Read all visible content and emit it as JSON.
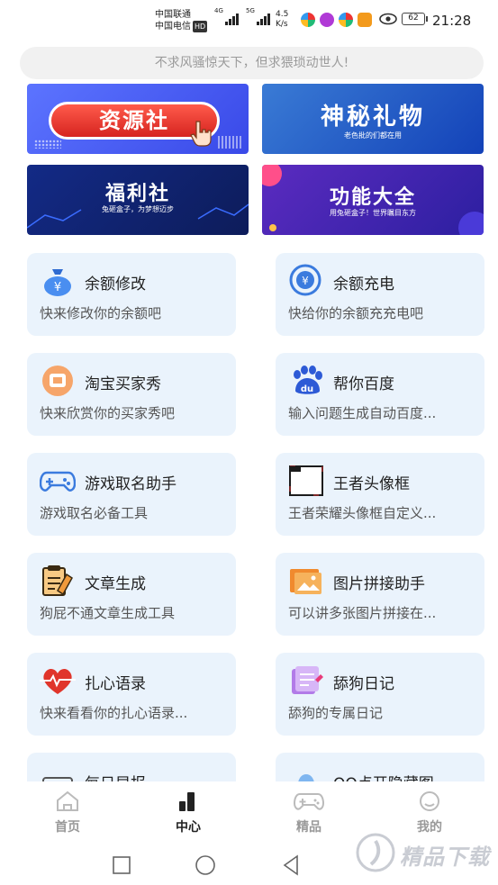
{
  "status_bar": {
    "carrier_1": "中国联通",
    "carrier_2": "中国电信",
    "hd": "HD",
    "sig1_label": "4G",
    "sig2_label": "5G",
    "speed_value": "4.5",
    "speed_unit": "K/s",
    "battery": "62",
    "time": "21:28"
  },
  "slogan": "不求风骚惊天下，但求猥琐动世人!",
  "banners": [
    {
      "title": "资源社",
      "subtitle": ""
    },
    {
      "title": "神秘礼物",
      "subtitle": "老色批的们都在用"
    },
    {
      "title": "福利社",
      "subtitle": "兔砸盒子，为梦想迈步"
    },
    {
      "title": "功能大全",
      "subtitle": "用兔砸盒子！世界瞩目东方"
    }
  ],
  "cards": [
    {
      "title": "余额修改",
      "desc": "快来修改你的余额吧",
      "icon": "money-bag-icon"
    },
    {
      "title": "余额充电",
      "desc": "快给你的余额充充电吧",
      "icon": "yen-coin-icon"
    },
    {
      "title": "淘宝买家秀",
      "desc": "快来欣赏你的买家秀吧",
      "icon": "taobao-icon"
    },
    {
      "title": "帮你百度",
      "desc": "输入问题生成自动百度...",
      "icon": "baidu-paw-icon"
    },
    {
      "title": "游戏取名助手",
      "desc": "游戏取名必备工具",
      "icon": "gamepad-icon"
    },
    {
      "title": "王者头像框",
      "desc": "王者荣耀头像框自定义...",
      "icon": "avatar-frame-icon"
    },
    {
      "title": "文章生成",
      "desc": "狗屁不通文章生成工具",
      "icon": "document-icon"
    },
    {
      "title": "图片拼接助手",
      "desc": "可以讲多张图片拼接在...",
      "icon": "image-collage-icon"
    },
    {
      "title": "扎心语录",
      "desc": "快来看看你的扎心语录...",
      "icon": "heartbeat-icon"
    },
    {
      "title": "舔狗日记",
      "desc": "舔狗的专属日记",
      "icon": "diary-icon"
    },
    {
      "title": "每日早报",
      "desc": "",
      "icon": "newspaper-icon"
    },
    {
      "title": "QQ点开隐藏图",
      "desc": "",
      "icon": "qq-icon"
    }
  ],
  "bottom_nav": [
    {
      "label": "首页",
      "icon": "home-icon",
      "active": false
    },
    {
      "label": "中心",
      "icon": "bar-chart-icon",
      "active": true
    },
    {
      "label": "精品",
      "icon": "gamepad-icon",
      "active": false
    },
    {
      "label": "我的",
      "icon": "smile-icon",
      "active": false
    }
  ],
  "watermark": "精品下载",
  "colors": {
    "card_bg": "#eaf3fc",
    "accent_red": "#e0352b",
    "accent_blue": "#3b7bde",
    "nav_active": "#222222",
    "nav_inactive": "#999999"
  }
}
